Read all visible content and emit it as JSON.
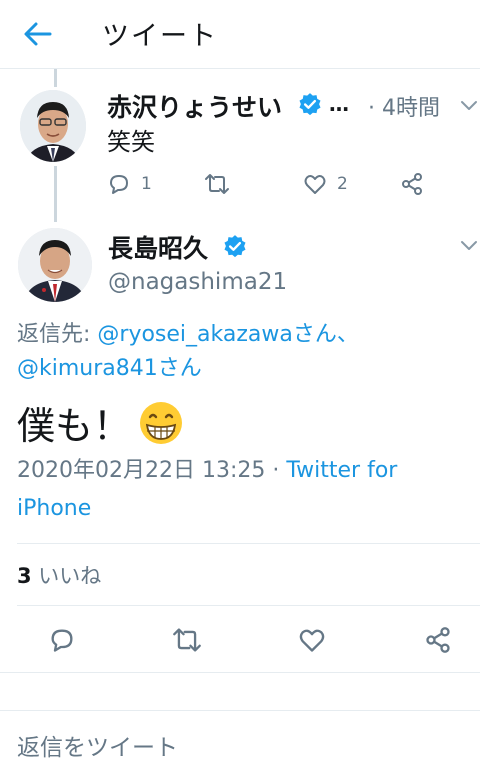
{
  "header": {
    "title": "ツイート",
    "back_icon": "arrow-left-icon"
  },
  "accent_color": "#1b95e0",
  "parent_tweet": {
    "display_name": "赤沢りょうせい",
    "ellipsis": "…",
    "time": "· 4時間",
    "text": "笑笑",
    "reply_count": "1",
    "retweet_count": "",
    "like_count": "2"
  },
  "main_tweet": {
    "display_name": "長島昭久",
    "handle": "@nagashima21",
    "reply_label": "返信先: ",
    "reply_user1": "@ryosei_akazawa",
    "reply_san1": "さん、",
    "reply_user2": "@kimura841",
    "reply_san2": "さん",
    "text": "僕も！",
    "emoji": "grinning-face-emoji",
    "datetime": "2020年02月22日 13:25",
    "source_sep": " · ",
    "source": "Twitter for iPhone",
    "likes_count": "3",
    "likes_label": " いいね"
  },
  "reply_placeholder": "返信をツイート"
}
